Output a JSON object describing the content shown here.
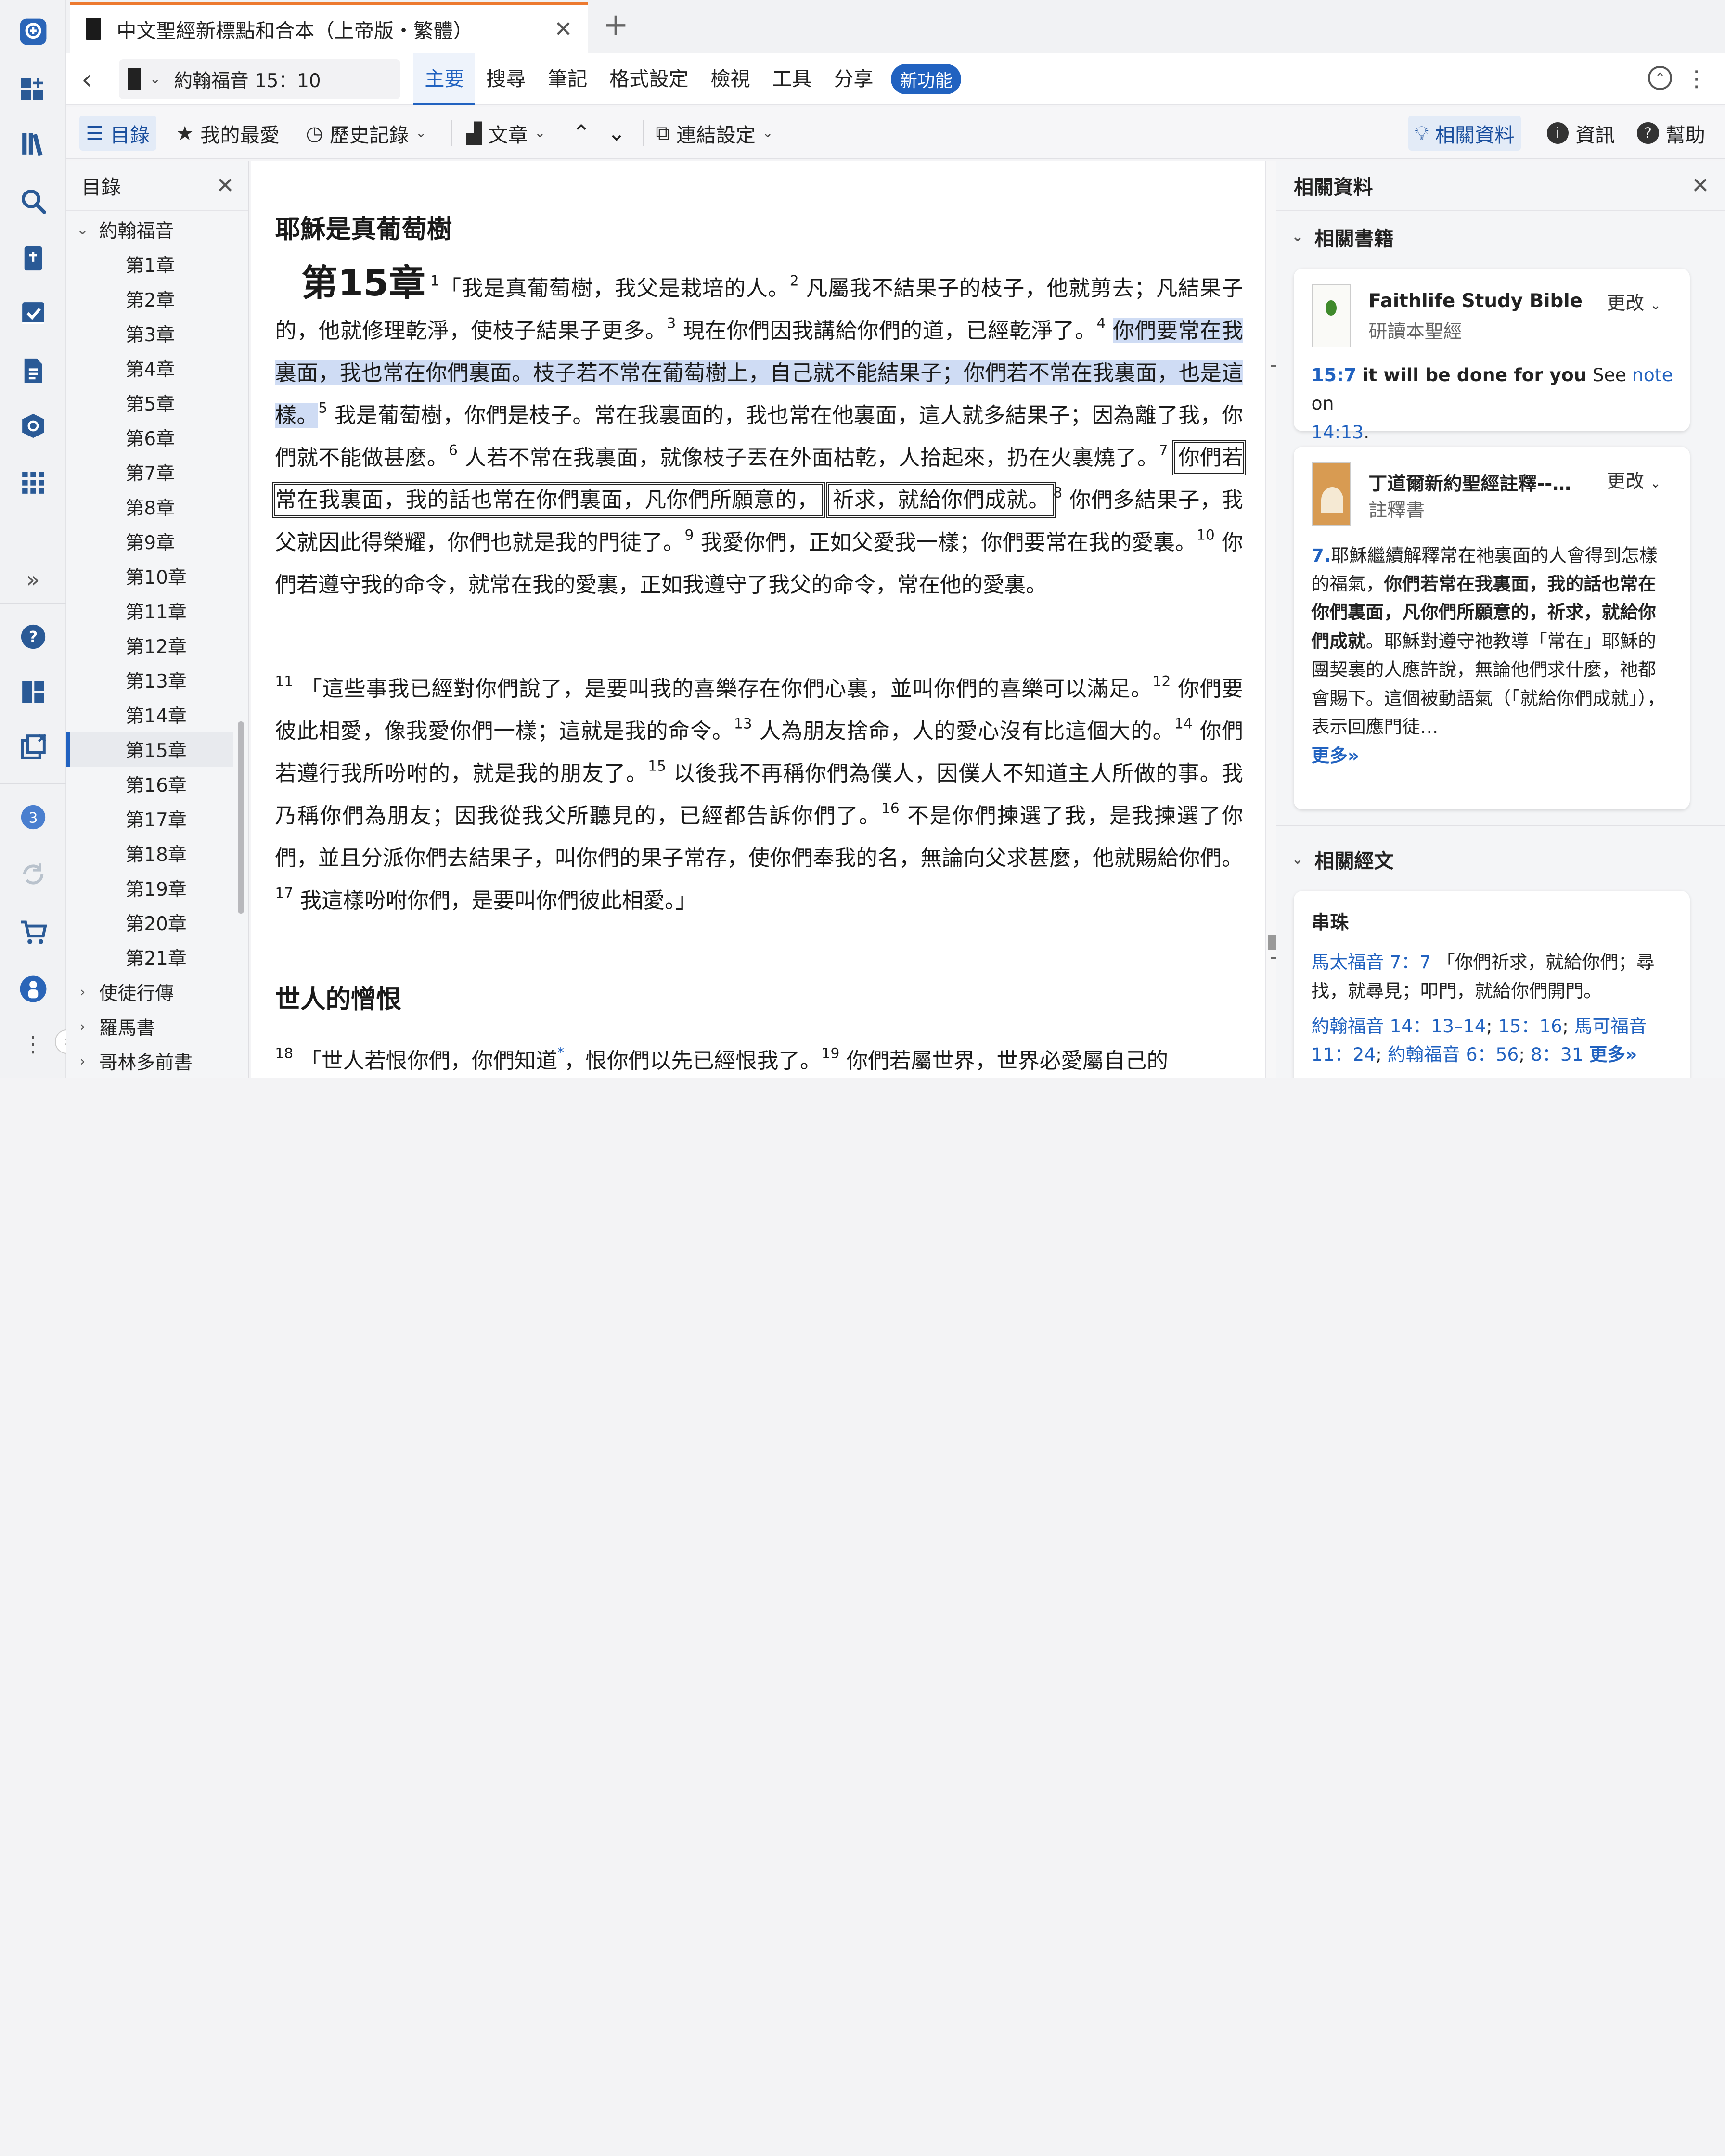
{
  "tab": {
    "title": "中文聖經新標點和合本（上帝版・繁體）",
    "close": "✕",
    "new": "+"
  },
  "nav": {
    "reference": "約翰福音 15：10",
    "menu": [
      "主要",
      "搜尋",
      "筆記",
      "格式設定",
      "檢視",
      "工具",
      "分享"
    ],
    "badge": "新功能"
  },
  "toolbar": {
    "toc": "目錄",
    "favorites": "我的最愛",
    "history": "歷史記錄",
    "text": "文章",
    "links": "連結設定",
    "related": "相關資料",
    "info": "資訊",
    "help": "幫助"
  },
  "toc": {
    "title": "目錄",
    "book": "約翰福音",
    "chapters": [
      "第1章",
      "第2章",
      "第3章",
      "第4章",
      "第5章",
      "第6章",
      "第7章",
      "第8章",
      "第9章",
      "第10章",
      "第11章",
      "第12章",
      "第13章",
      "第14章",
      "第15章",
      "第16章",
      "第17章",
      "第18章",
      "第19章",
      "第20章",
      "第21章"
    ],
    "current_index": 14,
    "after": [
      "使徒行傳",
      "羅馬書",
      "哥林多前書"
    ]
  },
  "reader": {
    "heading1": "耶穌是真葡萄樹",
    "chapter_label": "第15章",
    "v1": "「我是真葡萄樹，我父是栽培的人。",
    "v2": "凡屬我不結果子的枝子，他就剪去；凡結果子的，他就修理乾淨，使枝子結果子更多。",
    "v3": "現在你們因我講給你們的道，已經乾淨了。",
    "v4": "你們要常在我裏面，我也常在你們裏面。枝子若不常在葡萄樹上，自己就不能結果子；你們若不常在我裏面，也是這樣。",
    "v5": "我是葡萄樹，你們是枝子。常在我裏面的，我也常在他裏面，這人就多結果子；因為離了我，你們就不能做甚麼。",
    "v6": "人若不常在我裏面，就像枝子丟在外面枯乾，人拾起來，扔在火裏燒了。",
    "v7a": "你們若常在我裏面，我的話也常在你們裏面，凡你們所願意的，",
    "v7b": "祈求，就給你們成就。",
    "v8": "你們多結果子，我父就因此得榮耀，你們也就是我的門徒了。",
    "v9": "我愛你們，正如父愛我一樣；你們要常在我的愛裏。",
    "v10": "你們若遵守我的命令，就常在我的愛裏，正如我遵守了我父的命令，常在他的愛裏。",
    "v11": "「這些事我已經對你們說了，是要叫我的喜樂存在你們心裏，並叫你們的喜樂可以滿足。",
    "v12": "你們要彼此相愛，像我愛你們一樣；這就是我的命令。",
    "v13": "人為朋友捨命，人的愛心沒有比這個大的。",
    "v14": "你們若遵行我所吩咐的，就是我的朋友了。",
    "v15": "以後我不再稱你們為僕人，因僕人不知道主人所做的事。我乃稱你們為朋友；因我從我父所聽見的，已經都告訴你們了。",
    "v16": "不是你們揀選了我，是我揀選了你們，並且分派你們去結果子，叫你們的果子常存，使你們奉我的名，無論向父求甚麼，他就賜給你們。",
    "v17": "我這樣吩咐你們，是要叫你們彼此相愛。」",
    "heading2": "世人的憎恨",
    "v18a": "「世人若恨你們，你們知道",
    "v18b": "，恨你們以先已經恨我了。",
    "v19": "你們若屬世界，世界必愛屬自己的",
    "n": [
      "1",
      "2",
      "3",
      "4",
      "5",
      "6",
      "7",
      "8",
      "9",
      "10",
      "11",
      "12",
      "13",
      "14",
      "15",
      "16",
      "17",
      "18",
      "19"
    ]
  },
  "related": {
    "title": "相關資料",
    "books_section": "相關書籍",
    "change": "更改",
    "fsb_title": "Faithlife Study Bible",
    "fsb_sub": "研讀本聖經",
    "fsb_ref": "15:7",
    "fsb_bold": "it will be done for you",
    "fsb_see": "See",
    "fsb_note": "note",
    "fsb_on": "on",
    "fsb_link": "14:13",
    "comm_title": "丁道爾新約聖經註釋--…",
    "comm_sub": "註釋書",
    "comm_num": "7.",
    "comm_t1": "耶穌繼續解釋常在祂裏面的人會得到怎樣的福氣，",
    "comm_b": "你們若常在我裏面，我的話也常在你們裏面，凡你們所願意的，祈求，就給你們成就",
    "comm_t2": "。耶穌對遵守祂教導「常在」耶穌的團契裏的人應許說，無論他們求什麼，祂都會賜下。這個被動語氣（「就給你們成就」），表示回應門徒…",
    "more": "更多»",
    "verses_section": "相關經文",
    "xref_title": "串珠",
    "xref1_link": "馬太福音 7：7",
    "xref1_text": "「你們祈求，就給你們；尋找，就尋見；叩門，就給你們開門。",
    "xref2_l1": "約翰福音 14：13–14",
    "xref2_l2": "15：16",
    "xref2_l3": "馬可福音 11：24",
    "xref2_l4": "約翰福音 6：56",
    "xref2_l5": "8：31",
    "xref_more": "更多»"
  },
  "rail": {
    "badge_count": "3"
  },
  "colors": {
    "accent": "#2162c0",
    "tab_accent": "#ed7a2f",
    "highlight": "#cfdcf4"
  }
}
